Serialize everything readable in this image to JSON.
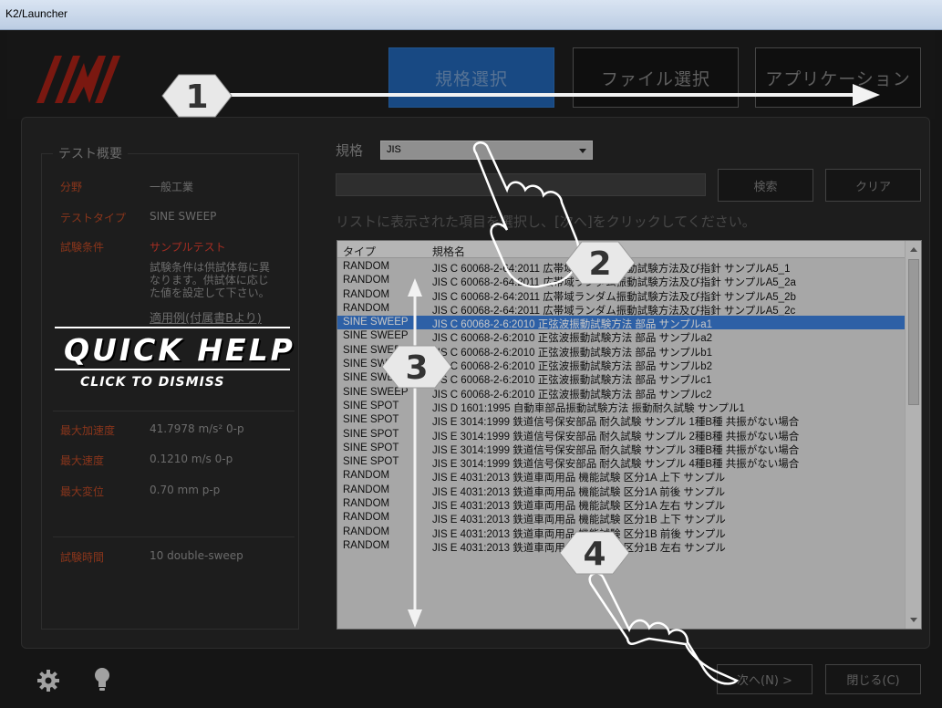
{
  "window": {
    "title": "K2/Launcher"
  },
  "nav": {
    "tabs": [
      {
        "label": "規格選択",
        "active": true
      },
      {
        "label": "ファイル選択",
        "active": false
      },
      {
        "label": "アプリケーション",
        "active": false
      }
    ]
  },
  "summary": {
    "title": "テスト概要",
    "field_label": "分野",
    "field_value": "一般工業",
    "type_label": "テストタイプ",
    "type_value": "SINE SWEEP",
    "cond_label": "試験条件",
    "cond_value": "サンプルテスト",
    "cond_desc": "試験条件は供試体毎に異なります。供試体に応じた値を設定して下さい。",
    "example_link": "適用例(付属書Bより)",
    "accel_label": "最大加速度",
    "accel_value": "41.7978 m/s² 0-p",
    "vel_label": "最大速度",
    "vel_value": "0.1210 m/s 0-p",
    "disp_label": "最大変位",
    "disp_value": "0.70 mm p-p",
    "time_label": "試験時間",
    "time_value": "10 double-sweep"
  },
  "standard": {
    "label": "規格",
    "selected": "JIS"
  },
  "search": {
    "search_label": "検索",
    "clear_label": "クリア"
  },
  "instruction": "リストに表示された項目を選択し、[次へ]をクリックしてください。",
  "list": {
    "col_type": "タイプ",
    "col_name": "規格名",
    "rows": [
      {
        "type": "RANDOM",
        "name": "JIS C 60068-2-64:2011 広帯域ランダム振動試験方法及び指針 サンプルA5_1"
      },
      {
        "type": "RANDOM",
        "name": "JIS C 60068-2-64:2011 広帯域ランダム振動試験方法及び指針 サンプルA5_2a"
      },
      {
        "type": "RANDOM",
        "name": "JIS C 60068-2-64:2011 広帯域ランダム振動試験方法及び指針 サンプルA5_2b"
      },
      {
        "type": "RANDOM",
        "name": "JIS C 60068-2-64:2011 広帯域ランダム振動試験方法及び指針 サンプルA5_2c"
      },
      {
        "type": "SINE SWEEP",
        "name": "JIS C 60068-2-6:2010 正弦波振動試験方法 部品 サンプルa1",
        "selected": true
      },
      {
        "type": "SINE SWEEP",
        "name": "JIS C 60068-2-6:2010 正弦波振動試験方法 部品 サンプルa2"
      },
      {
        "type": "SINE SWEEP",
        "name": "JIS C 60068-2-6:2010 正弦波振動試験方法 部品 サンプルb1"
      },
      {
        "type": "SINE SWEEP",
        "name": "JIS C 60068-2-6:2010 正弦波振動試験方法 部品 サンプルb2"
      },
      {
        "type": "SINE SWEEP",
        "name": "JIS C 60068-2-6:2010 正弦波振動試験方法 部品 サンプルc1"
      },
      {
        "type": "SINE SWEEP",
        "name": "JIS C 60068-2-6:2010 正弦波振動試験方法 部品 サンプルc2"
      },
      {
        "type": "SINE SPOT",
        "name": "JIS D 1601:1995 自動車部品振動試験方法 振動耐久試験 サンプル1"
      },
      {
        "type": "SINE SPOT",
        "name": "JIS E 3014:1999 鉄道信号保安部品 耐久試験 サンプル 1種B種 共振がない場合"
      },
      {
        "type": "SINE SPOT",
        "name": "JIS E 3014:1999 鉄道信号保安部品 耐久試験 サンプル 2種B種 共振がない場合"
      },
      {
        "type": "SINE SPOT",
        "name": "JIS E 3014:1999 鉄道信号保安部品 耐久試験 サンプル 3種B種 共振がない場合"
      },
      {
        "type": "SINE SPOT",
        "name": "JIS E 3014:1999 鉄道信号保安部品 耐久試験 サンプル 4種B種 共振がない場合"
      },
      {
        "type": "RANDOM",
        "name": "JIS E 4031:2013 鉄道車両用品 機能試験 区分1A 上下 サンプル"
      },
      {
        "type": "RANDOM",
        "name": "JIS E 4031:2013 鉄道車両用品 機能試験 区分1A 前後 サンプル"
      },
      {
        "type": "RANDOM",
        "name": "JIS E 4031:2013 鉄道車両用品 機能試験 区分1A 左右 サンプル"
      },
      {
        "type": "RANDOM",
        "name": "JIS E 4031:2013 鉄道車両用品 機能試験 区分1B 上下 サンプル"
      },
      {
        "type": "RANDOM",
        "name": "JIS E 4031:2013 鉄道車両用品 機能試験 区分1B 前後 サンプル"
      },
      {
        "type": "RANDOM",
        "name": "JIS E 4031:2013 鉄道車両用品 機能試験 区分1B 左右 サンプル"
      }
    ]
  },
  "footer": {
    "next_label": "次へ(N) >",
    "close_label": "閉じる(C)"
  },
  "quick_help": {
    "title": "QUICK HELP",
    "subtitle": "CLICK TO DISMISS",
    "step_1": "1",
    "step_2": "2",
    "step_3": "3",
    "step_4": "4"
  },
  "colors": {
    "accent": "#1f5ea8",
    "brand_red": "#b0271b",
    "label_orange": "#b04423"
  }
}
